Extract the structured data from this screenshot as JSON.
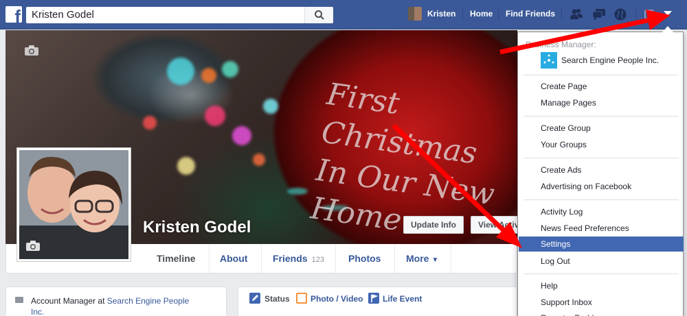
{
  "topbar": {
    "logo": "f",
    "search_value": "Kristen Godel",
    "user_name": "Kristen",
    "nav_home": "Home",
    "nav_find_friends": "Find Friends",
    "icons": [
      "friend-requests-icon",
      "messages-icon",
      "notifications-globe-icon",
      "privacy-lock-icon",
      "account-menu-caret-icon"
    ]
  },
  "cover": {
    "ornament_text_line1": "First Christmas",
    "ornament_text_line2": "In Our New Home",
    "profile_name": "Kristen Godel",
    "update_info_button": "Update Info",
    "view_activity_button": "View Activity Log"
  },
  "tabs": [
    {
      "label": "Timeline",
      "active": true
    },
    {
      "label": "About"
    },
    {
      "label": "Friends",
      "count": "123"
    },
    {
      "label": "Photos"
    },
    {
      "label": "More"
    }
  ],
  "intro": {
    "prefix": "Account Manager at ",
    "link": "Search Engine People Inc."
  },
  "composer": {
    "status": "Status",
    "photo_video": "Photo / Video",
    "life_event": "Life Event"
  },
  "dropdown": {
    "section_label": "Business Manager:",
    "business_name": "Search Engine People Inc.",
    "groups": [
      [
        "Create Page",
        "Manage Pages"
      ],
      [
        "Create Group",
        "Your Groups"
      ],
      [
        "Create Ads",
        "Advertising on Facebook"
      ],
      [
        "Activity Log",
        "News Feed Preferences",
        "Settings",
        "Log Out"
      ],
      [
        "Help",
        "Support Inbox",
        "Report a Problem"
      ]
    ],
    "highlighted": "Settings"
  },
  "colors": {
    "facebook_blue": "#3b5998",
    "highlight": "#4267b2",
    "link": "#365899",
    "annotation_arrow": "#ff0000"
  }
}
